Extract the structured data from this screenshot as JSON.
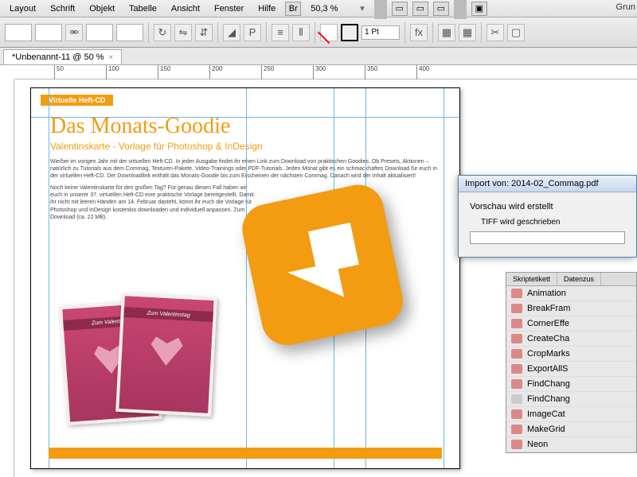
{
  "menu": {
    "items": [
      "Layout",
      "Schrift",
      "Objekt",
      "Tabelle",
      "Ansicht",
      "Fenster",
      "Hilfe"
    ],
    "zoom": "50,3 %",
    "right": "Grun"
  },
  "tab": {
    "title": "*Unbenannt-11 @ 50 %"
  },
  "ruler": {
    "ticks": [
      "50",
      "100",
      "150",
      "200",
      "250",
      "300",
      "350",
      "400"
    ]
  },
  "toolbar": {
    "stroke": "1 Pt"
  },
  "doc": {
    "badge": "Virtuelle Heft-CD",
    "headline": "Das Monats-Goodie",
    "subhead": "Valentinskarte - Vorlage für Photoshop & InDesign",
    "para1": "Wie/bei im vorigen Jahr mit der virtuellen Heft-CD. In jeder Ausgabe findet ihr einen Link zum Download von praktischen Goodies. Ob Presets, Aktionen – natürlich zu Tutorials aus dem Commag, Texturen-Pakete, Video-Trainings oder PDF-Tutorials. Jeden Monat gibt es ein schmackhaftes Download für euch in der virtuellen Heft-CD. Der Downloadlink enthält das Monats-Goodie bis zum Erscheinen der nächsten Commag. Danach wird der Inhalt aktualisiert!",
    "para2": "Noch keine Valentinskarte für den großen Tag? Für genau diesen Fall haben wir euch in unserer 37. virtuellen Heft-CD eine praktische Vorlage bereitgestellt. Damit ihr nicht mit leeren Händen am 14. Februar dasteht, könnt ihr euch die Vorlage für Photoshop und InDesign kostenlos downloaden und individuell anpassen. Zum Download (ca. 22 MB).",
    "card_ribbon1": "Zum Valentin",
    "card_ribbon2": "Zum Valentinstag"
  },
  "dialog": {
    "title": "Import von: 2014-02_Commag.pdf",
    "line1": "Vorschau wird erstellt",
    "line2": "TIFF wird geschrieben"
  },
  "panel": {
    "tabs": [
      "Skriptetikett",
      "Datenzus"
    ],
    "items": [
      {
        "label": "Animation",
        "type": "script"
      },
      {
        "label": "BreakFram",
        "type": "script"
      },
      {
        "label": "CornerEffe",
        "type": "script"
      },
      {
        "label": "CreateCha",
        "type": "script"
      },
      {
        "label": "CropMarks",
        "type": "script"
      },
      {
        "label": "ExportAllS",
        "type": "script"
      },
      {
        "label": "FindChang",
        "type": "script"
      },
      {
        "label": "FindChang",
        "type": "folder"
      },
      {
        "label": "ImageCat",
        "type": "script"
      },
      {
        "label": "MakeGrid",
        "type": "script"
      },
      {
        "label": "Neon",
        "type": "script"
      }
    ]
  }
}
